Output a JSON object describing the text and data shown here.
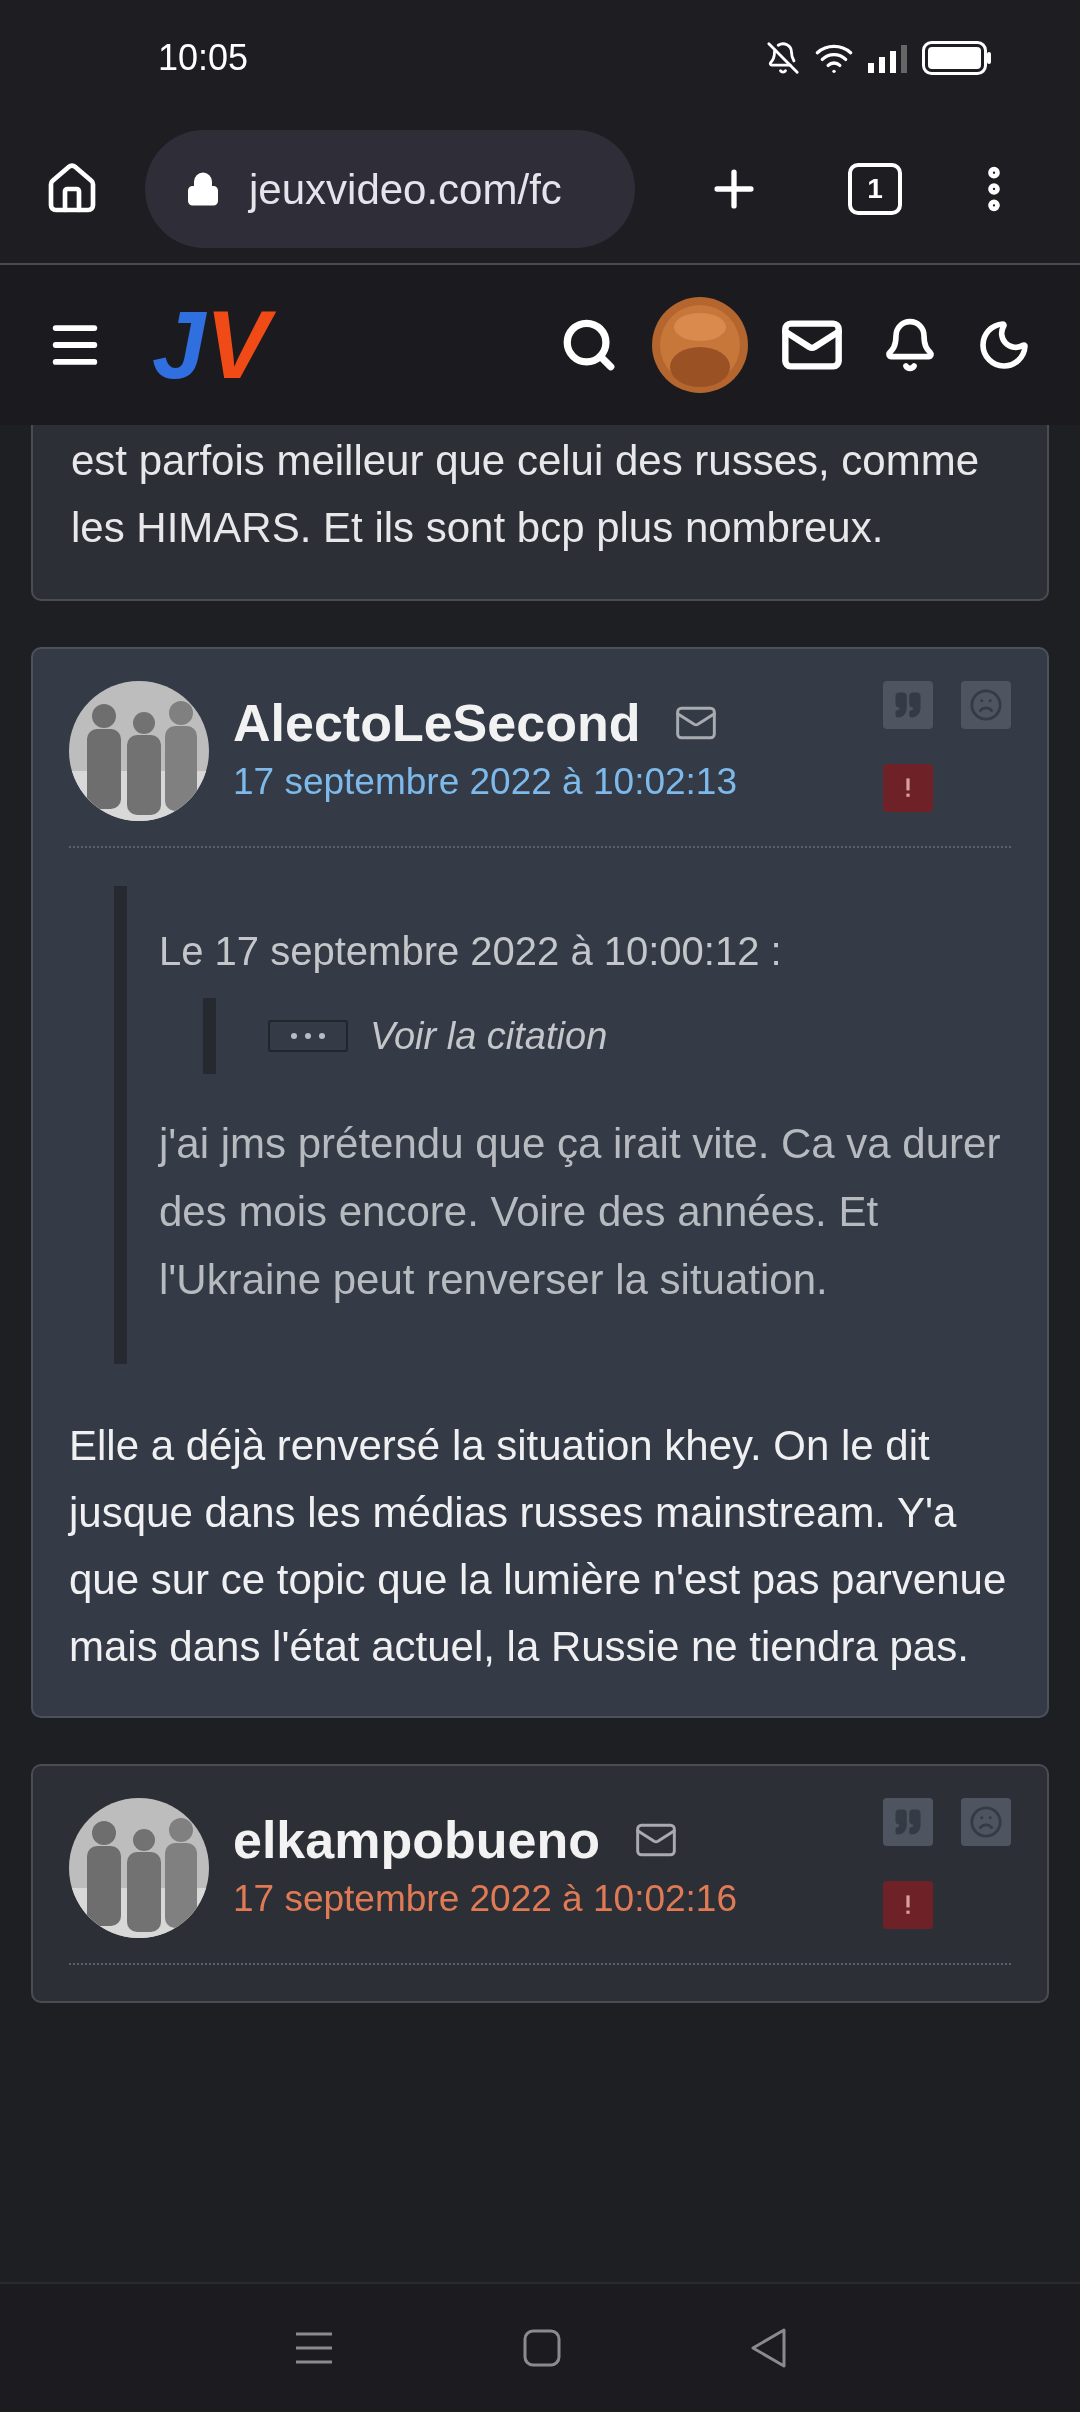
{
  "status_bar": {
    "time": "10:05"
  },
  "browser": {
    "url": "jeuxvideo.com/fc",
    "tab_count": "1"
  },
  "site_header": {
    "logo": "JV"
  },
  "posts": [
    {
      "kind": "fragment",
      "highlighted": false,
      "body": "est parfois meilleur que celui des russes, comme les HIMARS. Et ils sont bcp plus nombreux."
    },
    {
      "kind": "post",
      "highlighted": true,
      "author": "AlectoLeSecond",
      "date": "17 septembre 2022 à 10:02:13",
      "color": "#7db9ea",
      "quote": {
        "header": "Le 17 septembre 2022 à 10:00:12 :",
        "collapsed_label": "Voir la citation",
        "text": "j'ai jms prétendu que ça irait vite. Ca va durer des mois encore. Voire des années. Et l'Ukraine peut renverser la situation."
      },
      "body": "Elle a déjà renversé la situation khey. On le dit jusque dans les médias russes mainstream. Y'a que sur ce topic que la lumière n'est pas parvenue mais dans l'état actuel, la Russie ne tiendra pas."
    },
    {
      "kind": "post",
      "highlighted": false,
      "author": "elkampobueno",
      "date": "17 septembre 2022 à 10:02:16",
      "color": "#e07a55"
    }
  ]
}
